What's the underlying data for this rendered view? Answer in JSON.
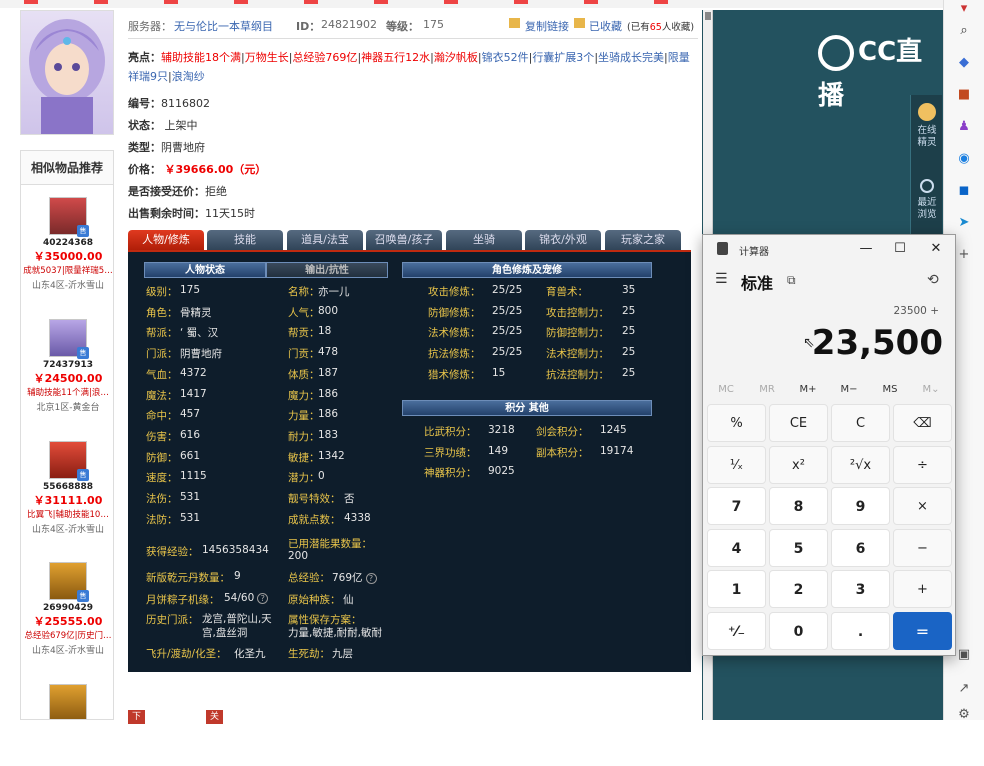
{
  "header": {
    "server_label": "服务器：",
    "server_value": "无与伦比一本草纲目",
    "id_label": "ID：",
    "id_value": "24821902",
    "level_label": "等级：",
    "level_value": "175",
    "copy_link": "复制链接",
    "favorited": "已收藏",
    "fav_count_prefix": "(已有",
    "fav_count": "65",
    "fav_count_suffix": "人收藏)"
  },
  "highlights": {
    "label": "亮点：",
    "items": [
      "辅助技能18个满",
      "万物生长",
      "总经验769亿",
      "神器五行12水",
      "瀚汐帆板",
      "锦衣52件",
      "行囊扩展3个",
      "坐骑成长完美",
      "限量祥瑞9只",
      "浪淘纱"
    ]
  },
  "props": {
    "number_label": "编号：",
    "number_value": "8116802",
    "status_label": "状态：",
    "status_value": "上架中",
    "type_label": "类型：",
    "type_value": "阴曹地府",
    "price_label": "价格：",
    "price_value": "￥39666.00（元）",
    "bargain_label": "是否接受还价：",
    "bargain_value": "拒绝",
    "time_label": "出售剩余时间：",
    "time_value": "11天15时"
  },
  "similar": {
    "title": "相似物品推荐",
    "items": [
      {
        "id": "40224368",
        "price": "￥35000.00",
        "desc": "成就5037|限量祥瑞5…",
        "server": "山东4区-沂水雪山"
      },
      {
        "id": "72437913",
        "price": "￥24500.00",
        "desc": "辅助技能11个满|浪…",
        "server": "北京1区-黄金台"
      },
      {
        "id": "55668888",
        "price": "￥31111.00",
        "desc": "比翼飞|辅助技能10…",
        "server": "山东4区-沂水雪山"
      },
      {
        "id": "26990429",
        "price": "￥25555.00",
        "desc": "总经验679亿|历史门…",
        "server": "山东4区-沂水雪山"
      }
    ],
    "badge": "售"
  },
  "tabs": [
    "人物/修炼",
    "技能",
    "道具/法宝",
    "召唤兽/孩子",
    "坐骑",
    "锦衣/外观",
    "玩家之家"
  ],
  "panel": {
    "sec_status": "人物状态",
    "sec_output": "输出/抗性",
    "sec_cultivation": "角色修炼及宠修",
    "sec_points": "积分 其他",
    "left": [
      {
        "k": "级别：",
        "v": "175"
      },
      {
        "k": "角色：",
        "v": "骨精灵"
      },
      {
        "k": "帮派：",
        "v": "‘ 蜀、汉"
      },
      {
        "k": "门派：",
        "v": "阴曹地府"
      },
      {
        "k": "气血：",
        "v": "4372"
      },
      {
        "k": "魔法：",
        "v": "1417"
      },
      {
        "k": "命中：",
        "v": "457"
      },
      {
        "k": "伤害：",
        "v": "616"
      },
      {
        "k": "防御：",
        "v": "661"
      },
      {
        "k": "速度：",
        "v": "1115"
      },
      {
        "k": "法伤：",
        "v": "531"
      },
      {
        "k": "法防：",
        "v": "531"
      }
    ],
    "right": [
      {
        "k": "名称：",
        "v": "亦一儿"
      },
      {
        "k": "人气：",
        "v": "800"
      },
      {
        "k": "帮贡：",
        "v": "18"
      },
      {
        "k": "门贡：",
        "v": "478"
      },
      {
        "k": "体质：",
        "v": "187"
      },
      {
        "k": "魔力：",
        "v": "186"
      },
      {
        "k": "力量：",
        "v": "186"
      },
      {
        "k": "耐力：",
        "v": "183"
      },
      {
        "k": "敏捷：",
        "v": "1342"
      },
      {
        "k": "潜力：",
        "v": "0"
      },
      {
        "k": "靓号特效：",
        "v": "否"
      },
      {
        "k": "成就点数：",
        "v": "4338"
      }
    ],
    "extra": {
      "exp_k": "获得经验：",
      "exp_v": "1456358434",
      "used_k": "已用潜能果数量：",
      "used_v": "200",
      "qyd_k": "新版乾元丹数量：",
      "qyd_v": "9",
      "total_k": "总经验：",
      "total_v": "769亿",
      "zongzi_k": "月饼粽子机缘：",
      "zongzi_v": "54/60",
      "race_k": "原始种族：",
      "race_v": "仙",
      "hist_k": "历史门派：",
      "hist_v": "龙宫,普陀山,天宫,盘丝洞",
      "save_k": "属性保存方案：",
      "save_v": "力量,敏捷,耐耐,敏耐",
      "fly_k": "飞升/渡劫/化圣：",
      "fly_v": "化圣九",
      "life_k": "生死劫：",
      "life_v": "九层",
      "hint": "?"
    },
    "cult": [
      {
        "k": "攻击修炼：",
        "v": "25/25",
        "k2": "育兽术：",
        "v2": "35"
      },
      {
        "k": "防御修炼：",
        "v": "25/25",
        "k2": "攻击控制力：",
        "v2": "25"
      },
      {
        "k": "法术修炼：",
        "v": "25/25",
        "k2": "防御控制力：",
        "v2": "25"
      },
      {
        "k": "抗法修炼：",
        "v": "25/25",
        "k2": "法术控制力：",
        "v2": "25"
      },
      {
        "k": "猎术修炼：",
        "v": "15",
        "k2": "抗法控制力：",
        "v2": "25"
      }
    ],
    "points": [
      {
        "k": "比武积分：",
        "v": "3218",
        "k2": "剑会积分：",
        "v2": "1245"
      },
      {
        "k": "三界功绩：",
        "v": "149",
        "k2": "副本积分：",
        "v2": "19174"
      },
      {
        "k": "神器积分：",
        "v": "9025",
        "k2": "",
        "v2": ""
      }
    ]
  },
  "bottom": {
    "buy": "下单购买",
    "close": "关闭"
  },
  "overlay": {
    "logo_text": "CC直播",
    "tool_online": "在线精灵",
    "tool_recent": "最近浏览"
  },
  "calculator": {
    "title": "计算器",
    "mode": "标准",
    "expression": "23500 +",
    "display": "23,500",
    "memory": [
      "MC",
      "MR",
      "M+",
      "M−",
      "MS",
      "M⌄"
    ],
    "keys": [
      [
        "%",
        "CE",
        "C",
        "⌫"
      ],
      [
        "¹⁄ₓ",
        "x²",
        "²√x",
        "÷"
      ],
      [
        "7",
        "8",
        "9",
        "×"
      ],
      [
        "4",
        "5",
        "6",
        "−"
      ],
      [
        "1",
        "2",
        "3",
        "+"
      ],
      [
        "⁺⁄₋",
        "0",
        ".",
        "="
      ]
    ]
  }
}
